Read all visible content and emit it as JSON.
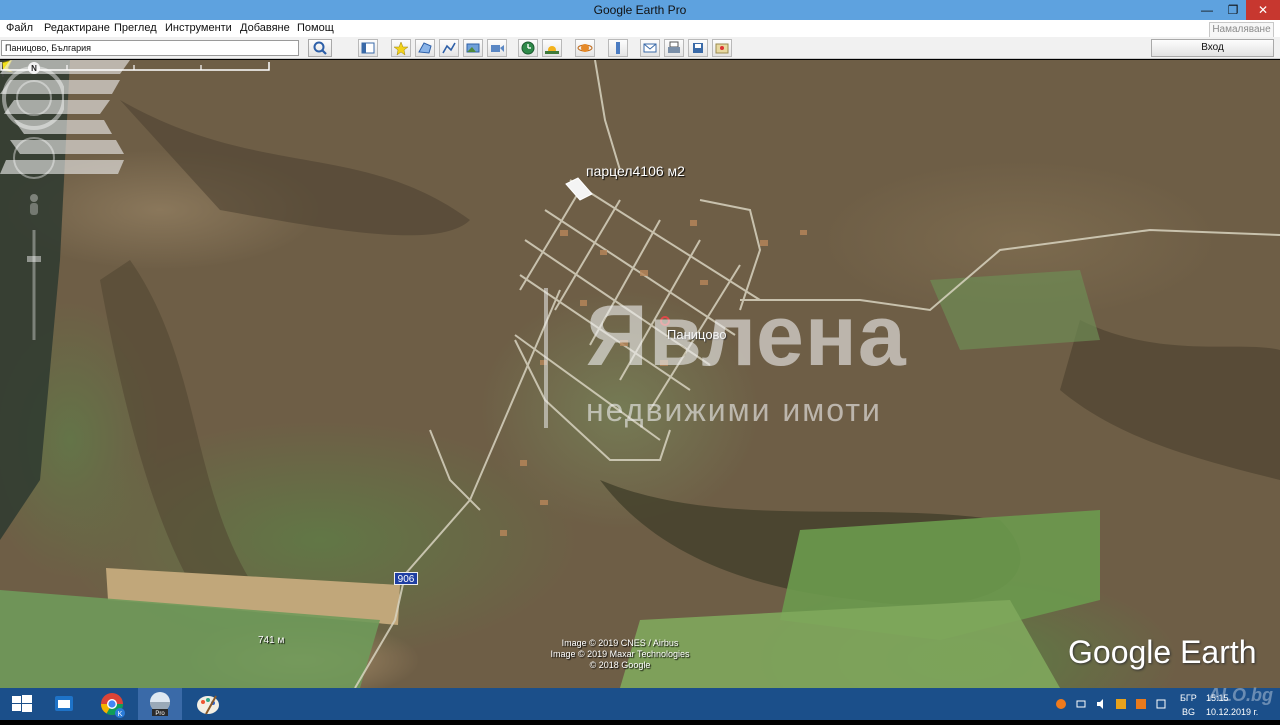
{
  "window": {
    "title": "Google Earth Pro",
    "minimize": "—",
    "maximize": "❐",
    "close": "✕"
  },
  "menu": {
    "items": [
      "Файл",
      "Редактиране",
      "Преглед",
      "Инструменти",
      "Добавяне",
      "Помощ"
    ],
    "signout_label": "Намаляване"
  },
  "toolbar": {
    "search_value": "Паницово, България",
    "search_icon": "magnifier-icon",
    "login_label": "Вход",
    "tool_icons": [
      "sidebar-toggle-icon",
      "placemark-icon",
      "polygon-icon",
      "path-icon",
      "image-overlay-icon",
      "tour-record-icon",
      "historical-imagery-icon",
      "sunlight-icon",
      "planets-icon",
      "ruler-icon",
      "email-icon",
      "print-icon",
      "save-image-icon",
      "google-maps-icon"
    ]
  },
  "map": {
    "placemark_label": "парцел4106 м2",
    "village_label": "Паницово",
    "road_number": "906",
    "watermark_brand": "Явлена",
    "watermark_sub": "недвижими имоти",
    "scale_label": "741 м",
    "credits": [
      "Image © 2019 CNES / Airbus",
      "Image © 2019 Maxar Technologies",
      "© 2018 Google"
    ],
    "brand": "Google Earth",
    "compass_north": "N"
  },
  "taskbar": {
    "apps": [
      "windows-start-icon",
      "outlook-icon",
      "chrome-icon",
      "google-earth-pro-icon",
      "paint-icon"
    ],
    "earth_badge": "Pro",
    "chrome_badge": "K",
    "lang_top": "БГР",
    "lang_bottom": "BG",
    "time": "15:15",
    "date": "10.12.2019 г.",
    "site_mark": "ALO.bg"
  },
  "colors": {
    "titlebar": "#5ea2df",
    "taskbar": "#1b4f8a",
    "road_shield": "#1f3fa3",
    "placemark": "#f2e21b"
  }
}
